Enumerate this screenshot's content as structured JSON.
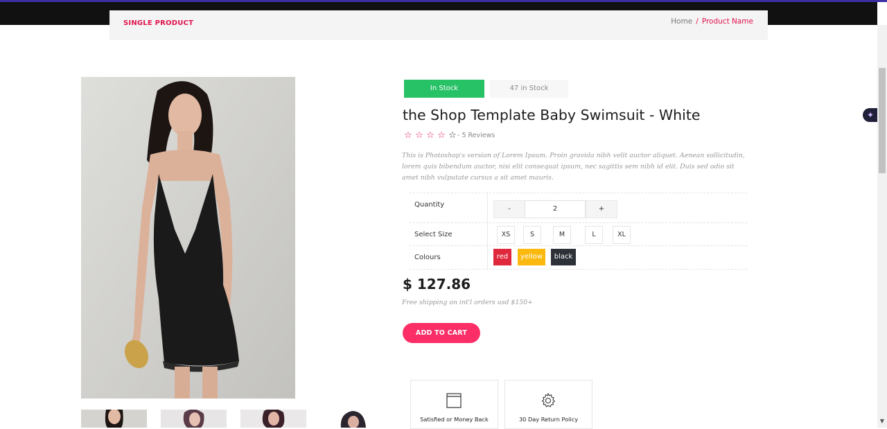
{
  "header": {
    "page_title": "SINGLE PRODUCT",
    "breadcrumb": {
      "home": "Home",
      "separator": "/",
      "current": "Product Name"
    }
  },
  "product": {
    "stock_status": "In Stock",
    "stock_count": "47 in Stock",
    "name": "the Shop Template Baby Swimsuit - White",
    "rating": {
      "filled": 4,
      "total": 5,
      "reviews_text": "- 5 Reviews"
    },
    "description": "This is Photoshop's version of Lorem Ipsum. Proin gravida nibh velit auctor aliquet. Aenean sollicitudin, lorem quis bibendum auctor, nisi elit consequat ipsum, nec sagittis sem nibh id elit. Duis sed odio sit amet nibh vulputate cursus a sit amet mauris.",
    "price": "$ 127.86",
    "shipping_note": "Free shipping on int'l orders usd $150+",
    "add_to_cart_label": "ADD TO CART"
  },
  "options": {
    "quantity": {
      "label": "Quantity",
      "minus": "-",
      "value": "2",
      "plus": "+"
    },
    "size": {
      "label": "Select Size",
      "items": [
        "XS",
        "S",
        "M",
        "L",
        "XL"
      ]
    },
    "colours": {
      "label": "Colours",
      "items": [
        {
          "name": "red",
          "color": "#e0283c"
        },
        {
          "name": "yellow",
          "color": "#fbb80f"
        },
        {
          "name": "black",
          "color": "#2d3138"
        }
      ]
    }
  },
  "features": [
    {
      "label": "Satisfied or Money Back",
      "icon": "browser-window-icon"
    },
    {
      "label": "30 Day Return Policy",
      "icon": "gear-icon"
    }
  ],
  "theme": {
    "accent": "#e1134b",
    "stock_green": "#27c166",
    "cart_button": "#fb2e67"
  }
}
